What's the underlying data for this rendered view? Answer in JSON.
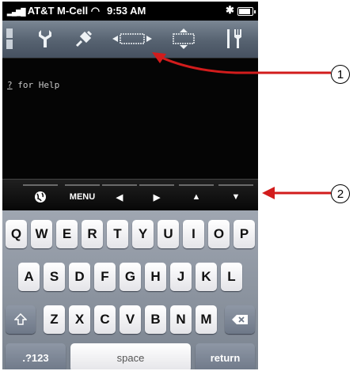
{
  "status_bar": {
    "carrier": "AT&T M-Cell",
    "time": "9:53 AM"
  },
  "toolbar": {
    "items": [
      {
        "name": "menu-handle",
        "icon": "vertical-bars-icon"
      },
      {
        "name": "settings",
        "icon": "wrench-icon"
      },
      {
        "name": "connect",
        "icon": "plug-icon"
      },
      {
        "name": "keyboard-hide",
        "icon": "keyboard-left-right-icon"
      },
      {
        "name": "keyboard-toggle",
        "icon": "keyboard-up-down-icon"
      },
      {
        "name": "tools",
        "icon": "fork-knife-icon"
      }
    ]
  },
  "terminal": {
    "help_key": "?",
    "help_text": " for Help"
  },
  "key_bar": {
    "globe_icon": "globe-icon",
    "menu_label": "MENU",
    "left_arrow": "◀",
    "right_arrow": "▶",
    "up_arrow": "▲",
    "down_arrow": "▼"
  },
  "keyboard": {
    "row1": [
      "Q",
      "W",
      "E",
      "R",
      "T",
      "Y",
      "U",
      "I",
      "O",
      "P"
    ],
    "row2": [
      "A",
      "S",
      "D",
      "F",
      "G",
      "H",
      "J",
      "K",
      "L"
    ],
    "row3": [
      "Z",
      "X",
      "C",
      "V",
      "B",
      "N",
      "M"
    ],
    "numbers_label": ".?123",
    "space_label": "space",
    "return_label": "return"
  },
  "callouts": {
    "one": "1",
    "two": "2"
  },
  "colors": {
    "callout_red": "#d21c1c",
    "toolbar_top": "#7b8794",
    "toolbar_bottom": "#465160"
  }
}
